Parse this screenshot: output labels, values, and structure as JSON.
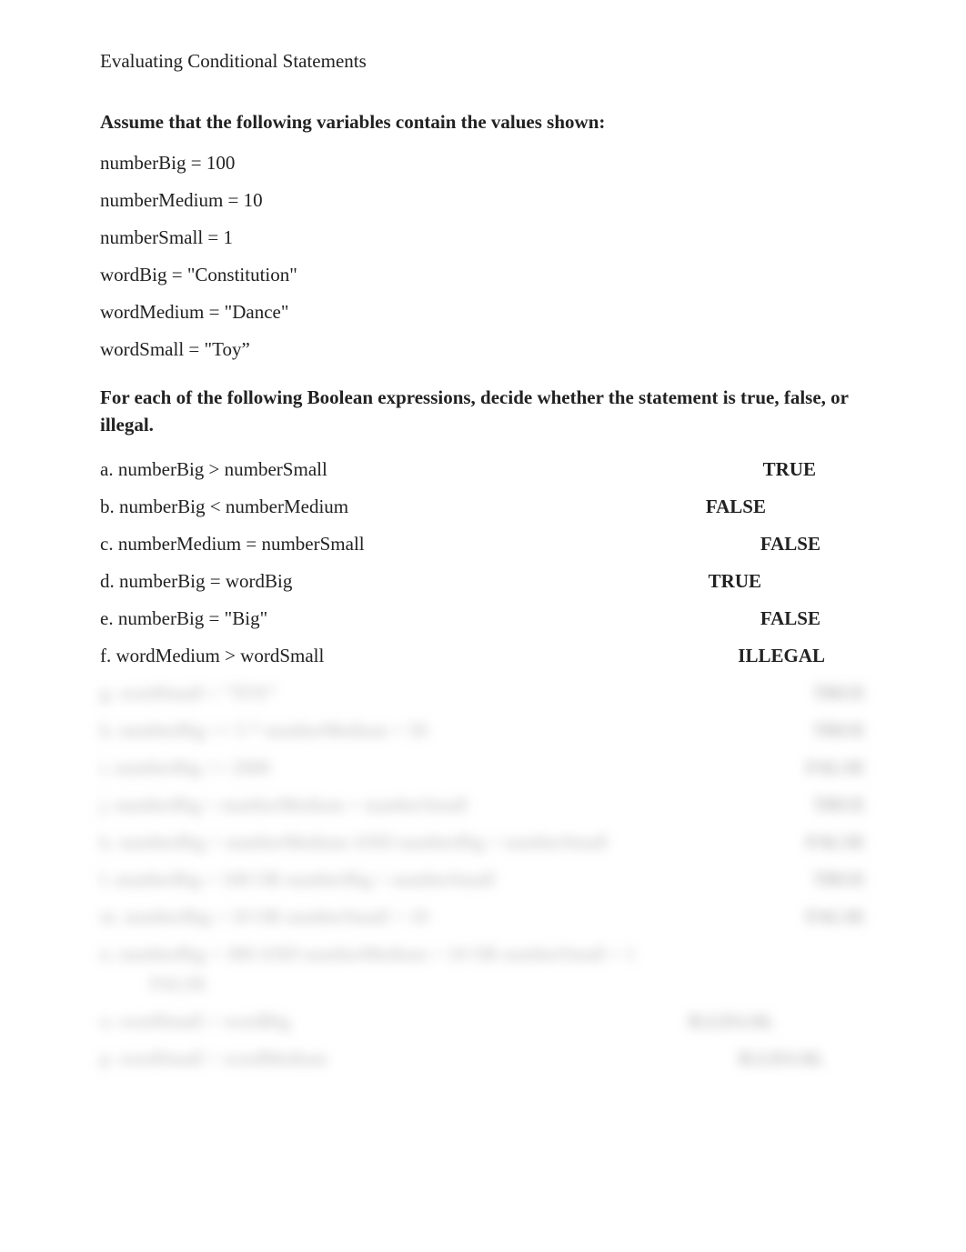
{
  "title": "Evaluating Conditional Statements",
  "assume_line": "Assume that the following variables contain the values shown:",
  "vars": {
    "v1": "numberBig = 100",
    "v2": "numberMedium = 10",
    "v3": "numberSmall = 1",
    "v4": "wordBig = \"Constitution\"",
    "v5": "wordMedium = \"Dance\"",
    "v6": "wordSmall = \"Toy”"
  },
  "instructions": "For each of the following Boolean expressions, decide whether the statement is true, false, or illegal.",
  "items": {
    "a": {
      "q": "a. numberBig > numberSmall",
      "a": "TRUE"
    },
    "b": {
      "q": "b. numberBig < numberMedium",
      "a": "FALSE"
    },
    "c": {
      "q": "c. numberMedium = numberSmall",
      "a": "FALSE"
    },
    "d": {
      "q": "d. numberBig = wordBig",
      "a": "TRUE"
    },
    "e": {
      "q": "e. numberBig = \"Big\"",
      "a": "FALSE"
    },
    "f": {
      "q": "f. wordMedium > wordSmall",
      "a": "ILLEGAL"
    },
    "g": {
      "q": "g. wordSmall = \"TOY\"",
      "a": "TRUE"
    },
    "h": {
      "q": "h. numberBig <= 5 * numberMedium + 50",
      "a": "TRUE"
    },
    "i": {
      "q": "i. numberBig >= 2000",
      "a": "FALSE"
    },
    "j": {
      "q": "j. numberBig > numberMedium + numberSmall",
      "a": "TRUE"
    },
    "k": {
      "q": "k. numberBig > numberMedium AND numberBig < numberSmall",
      "a": "FALSE"
    },
    "l": {
      "q": "l. numberBig = 100 OR numberBig > numberSmall",
      "a": "TRUE"
    },
    "m": {
      "q": "m. numberBig < 10 OR numberSmall > 10",
      "a": "FALSE"
    },
    "n": {
      "q": "n. numberBig = 300 AND numberMedium = 10 OR numberSmall = 1",
      "a": ""
    },
    "n_indent": "FALSE",
    "o": {
      "q": "o. wordSmall > wordBig",
      "a": "ILLEGAL"
    },
    "p": {
      "q": "p. wordSmall > wordMedium",
      "a": "ILLEGAL"
    }
  }
}
